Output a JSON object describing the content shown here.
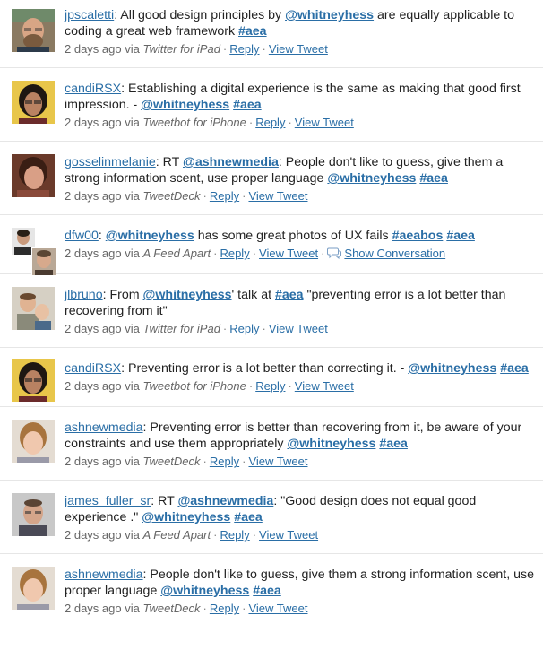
{
  "tweets": [
    {
      "user": "jpscaletti",
      "text_parts": [
        ": All good design principles by ",
        "@whitneyhess",
        " are equally applicable to coding a great web framework ",
        "#aea"
      ],
      "time": "2 days ago via",
      "source": "Twitter for iPad",
      "reply": "Reply",
      "view": "View Tweet"
    },
    {
      "user": "candiRSX",
      "text_parts": [
        ": Establishing a digital experience is the same as making that good first impression. - ",
        "@whitneyhess",
        " ",
        "#aea"
      ],
      "time": "2 days ago via",
      "source": "Tweetbot for iPhone",
      "reply": "Reply",
      "view": "View Tweet"
    },
    {
      "user": "gosselinmelanie",
      "text_parts": [
        ": RT ",
        "@ashnewmedia",
        ": People don't like to guess, give them a strong information scent, use proper language ",
        "@whitneyhess",
        " ",
        "#aea"
      ],
      "time": "2 days ago via",
      "source": "TweetDeck",
      "reply": "Reply",
      "view": "View Tweet"
    },
    {
      "user": "dfw00",
      "text_parts": [
        ": ",
        "@whitneyhess",
        " has some great photos of UX fails ",
        "#aeabos",
        " ",
        "#aea"
      ],
      "time": "2 days ago via",
      "source": "A Feed Apart",
      "reply": "Reply",
      "view": "View Tweet",
      "conversation": "Show Conversation"
    },
    {
      "user": "jlbruno",
      "text_parts": [
        ": From ",
        "@whitneyhess",
        "' talk at ",
        "#aea",
        " \"preventing error is a lot better than recovering from it\""
      ],
      "time": "2 days ago via",
      "source": "Twitter for iPad",
      "reply": "Reply",
      "view": "View Tweet"
    },
    {
      "user": "candiRSX",
      "text_parts": [
        ": Preventing error is a lot better than correcting it. - ",
        "@whitneyhess",
        " ",
        "#aea"
      ],
      "time": "2 days ago via",
      "source": "Tweetbot for iPhone",
      "reply": "Reply",
      "view": "View Tweet"
    },
    {
      "user": "ashnewmedia",
      "text_parts": [
        ": Preventing error is better than recovering from it, be aware of your constraints and use them appropriately ",
        "@whitneyhess",
        " ",
        "#aea"
      ],
      "time": "2 days ago via",
      "source": "TweetDeck",
      "reply": "Reply",
      "view": "View Tweet"
    },
    {
      "user": "james_fuller_sr",
      "text_parts": [
        ": RT ",
        "@ashnewmedia",
        ": \"Good design does not equal good experience .\" ",
        "@whitneyhess",
        " ",
        "#aea"
      ],
      "time": "2 days ago via",
      "source": "A Feed Apart",
      "reply": "Reply",
      "view": "View Tweet"
    },
    {
      "user": "ashnewmedia",
      "text_parts": [
        ": People don't like to guess, give them a strong information scent, use proper language ",
        "@whitneyhess",
        " ",
        "#aea"
      ],
      "time": "2 days ago via",
      "source": "TweetDeck",
      "reply": "Reply",
      "view": "View Tweet"
    }
  ],
  "separator": "·",
  "colors": {
    "link": "#2a6ea6",
    "meta": "#666666",
    "divider": "#e6e6e6"
  }
}
